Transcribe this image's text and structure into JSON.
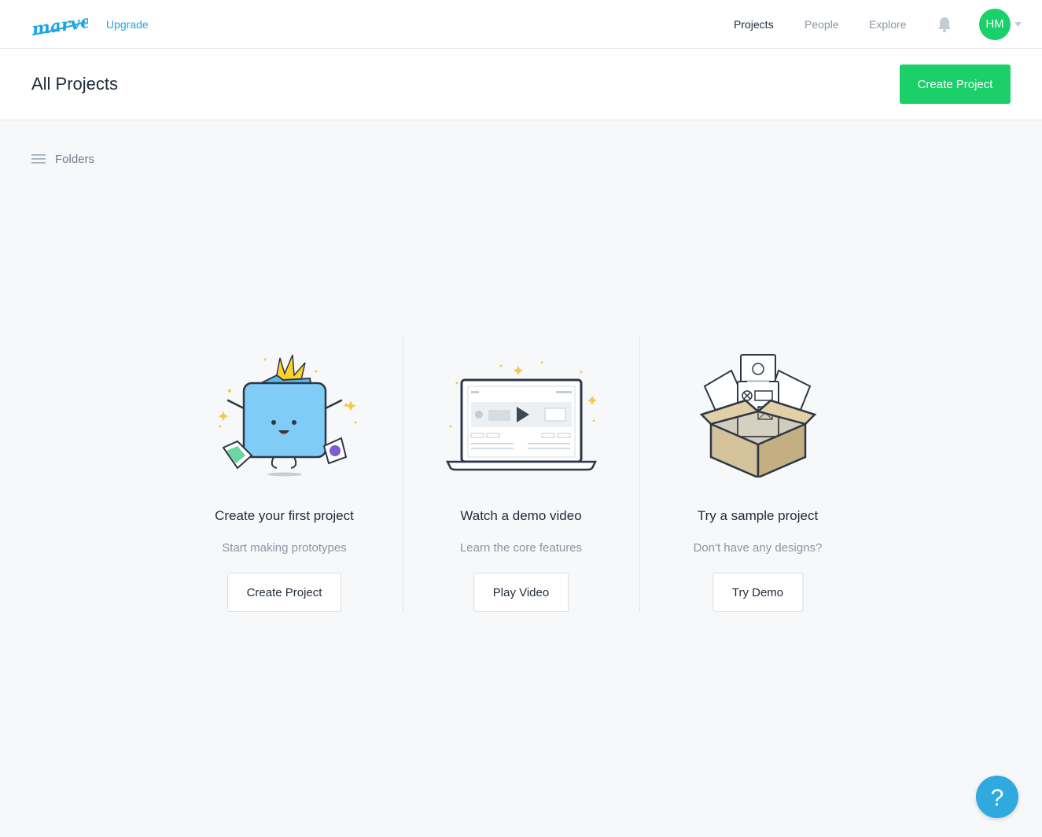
{
  "topbar": {
    "logo_text": "marvel",
    "upgrade_label": "Upgrade",
    "nav": [
      {
        "label": "Projects",
        "active": true
      },
      {
        "label": "People",
        "active": false
      },
      {
        "label": "Explore",
        "active": false
      }
    ],
    "bell_icon": "bell-icon",
    "avatar_initials": "HM",
    "avatar_color": "#1ad06b",
    "accent_color": "#1fa6e0"
  },
  "header": {
    "title": "All Projects",
    "create_label": "Create Project",
    "create_color": "#1bcf69"
  },
  "folders": {
    "icon": "hamburger-icon",
    "label": "Folders"
  },
  "cards": [
    {
      "illustration": "folder-character-illustration",
      "title": "Create your first project",
      "subtitle": "Start making prototypes",
      "button": "Create Project"
    },
    {
      "illustration": "laptop-video-illustration",
      "title": "Watch a demo video",
      "subtitle": "Learn the core features",
      "button": "Play Video"
    },
    {
      "illustration": "box-of-screens-illustration",
      "title": "Try a sample project",
      "subtitle": "Don't have any designs?",
      "button": "Try Demo"
    }
  ],
  "help": {
    "icon": "question-icon",
    "label": "?",
    "color": "#2fa9de"
  }
}
